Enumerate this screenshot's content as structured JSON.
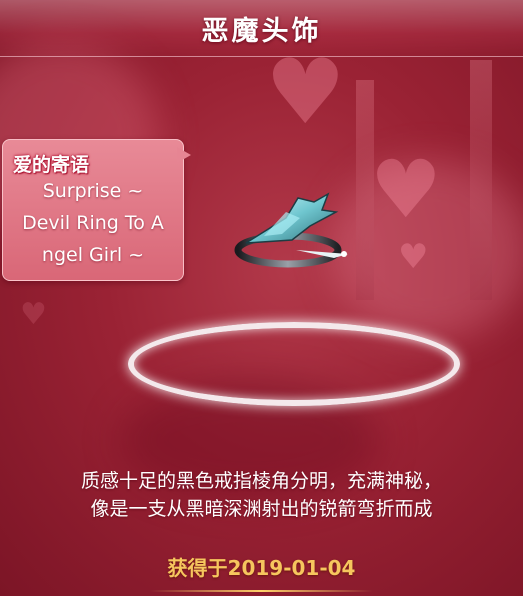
{
  "header": {
    "title": "恶魔头饰"
  },
  "message_card": {
    "heading": "爱的寄语",
    "lines": [
      "Surprise ~",
      "Devil Ring To A",
      "ngel Girl ~"
    ]
  },
  "item": {
    "icon": "devil-ring-icon"
  },
  "description": {
    "line1": "质感十足的黑色戒指棱角分明，充满神秘，",
    "line2": "像是一支从黑暗深渊射出的锐箭弯折而成"
  },
  "acquired": {
    "text": "获得于2019-01-04"
  },
  "colors": {
    "background": "#9a2234",
    "card": "#e07786",
    "accent_gold": "#f6c65e",
    "heading_red": "#b41836"
  }
}
